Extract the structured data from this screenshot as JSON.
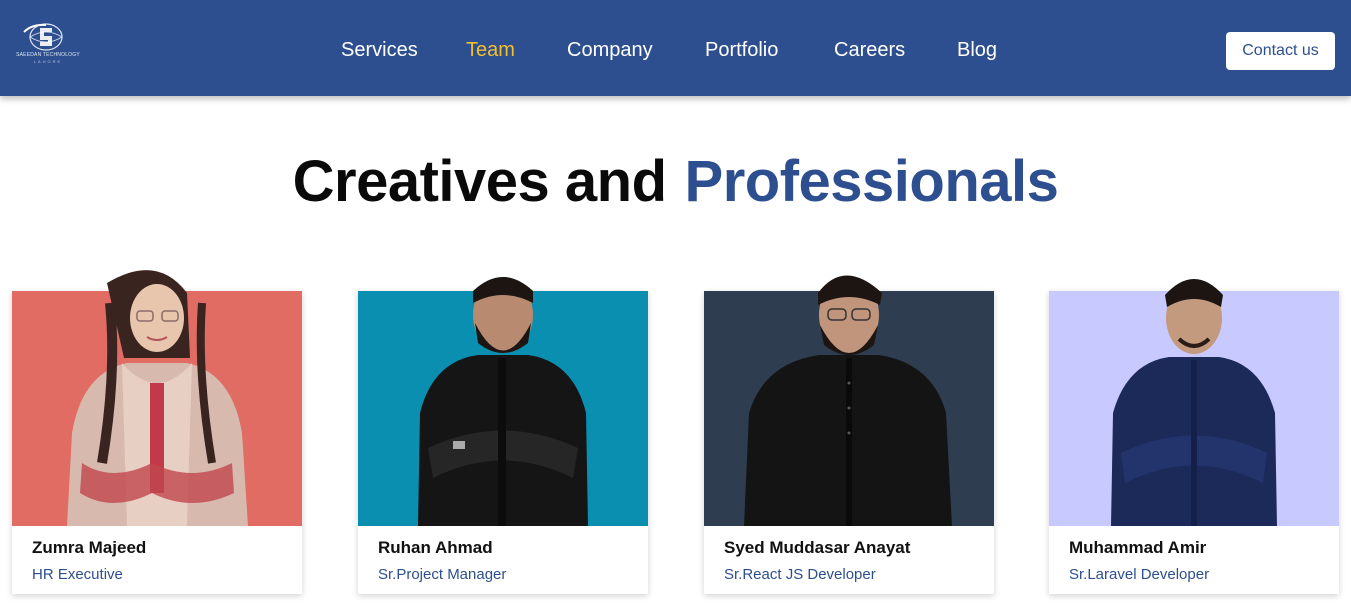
{
  "brand": {
    "logo_text": "SAEEDAN TECHNOLOGY",
    "logo_sub": "LAHORE"
  },
  "nav": {
    "items": [
      {
        "label": "Services",
        "active": false
      },
      {
        "label": "Team",
        "active": true
      },
      {
        "label": "Company",
        "active": false
      },
      {
        "label": "Portfolio",
        "active": false
      },
      {
        "label": "Careers",
        "active": false
      },
      {
        "label": "Blog",
        "active": false
      }
    ],
    "contact_label": "Contact us"
  },
  "hero": {
    "title_dark": "Creatives and",
    "title_blue": "Professionals"
  },
  "team": [
    {
      "name": "Zumra Majeed",
      "role": "HR Executive",
      "bg_color": "#e06c63"
    },
    {
      "name": "Ruhan Ahmad",
      "role": "Sr.Project Manager",
      "bg_color": "#0a8fb1"
    },
    {
      "name": "Syed Muddasar Anayat",
      "role": "Sr.React JS Developer",
      "bg_color": "#2e3e50"
    },
    {
      "name": "Muhammad Amir",
      "role": "Sr.Laravel Developer",
      "bg_color": "#c8caff"
    }
  ],
  "colors": {
    "nav_bg": "#2e4f8f",
    "accent": "#f5bf2b",
    "brand_blue": "#2e4f8f"
  }
}
